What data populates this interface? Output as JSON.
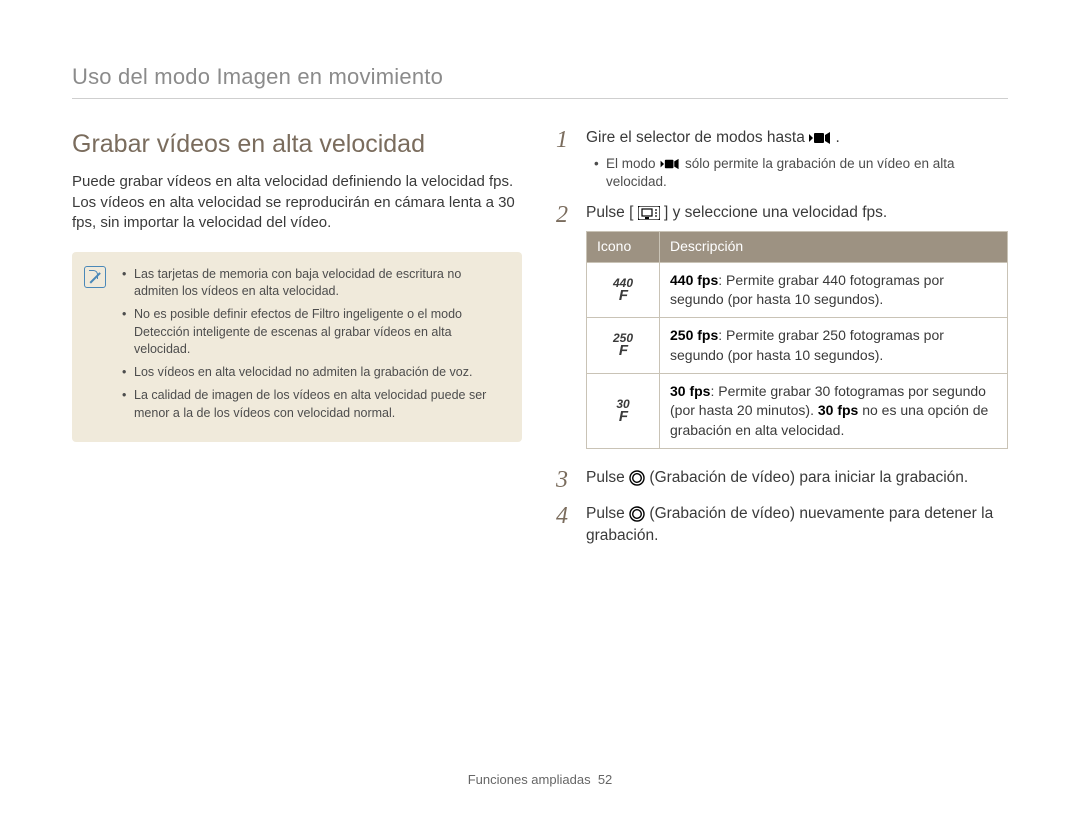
{
  "page_header": "Uso del modo Imagen en movimiento",
  "left": {
    "title": "Grabar vídeos en alta velocidad",
    "intro": "Puede grabar vídeos en alta velocidad definiendo la velocidad fps. Los vídeos en alta velocidad se reproducirán en cámara lenta a 30 fps, sin importar la velocidad del vídeo.",
    "note_bullets": [
      "Las tarjetas de memoria con baja velocidad de escritura no admiten los vídeos en alta velocidad.",
      "No es posible definir efectos de Filtro ingeligente o el modo Detección inteligente de escenas al grabar vídeos en alta velocidad.",
      "Los vídeos en alta velocidad no admiten la grabación de voz.",
      "La calidad de imagen de los vídeos en alta velocidad puede ser menor a la de los vídeos con velocidad normal."
    ]
  },
  "steps": {
    "s1": {
      "text_before": "Gire el selector de modos hasta ",
      "text_after": " .",
      "sub_before": "El modo ",
      "sub_after": " sólo permite la grabación de un vídeo en alta velocidad."
    },
    "s2": {
      "text_before": "Pulse [",
      "text_after": "] y seleccione una velocidad fps."
    },
    "s3": {
      "text_before": "Pulse ",
      "text_after": " (Grabación de vídeo) para iniciar la grabación."
    },
    "s4": {
      "text_before": "Pulse ",
      "text_mid": " (Grabación de vídeo) nuevamente para detener la grabación."
    }
  },
  "table": {
    "header_icon": "Icono",
    "header_desc": "Descripción",
    "rows": [
      {
        "icon_top": "440",
        "icon_bottom": "F",
        "bold": "440 fps",
        "desc": ": Permite grabar 440 fotogramas por segundo (por hasta 10 segundos).",
        "extra": ""
      },
      {
        "icon_top": "250",
        "icon_bottom": "F",
        "bold": "250 fps",
        "desc": ": Permite grabar 250 fotogramas por segundo (por hasta 10 segundos).",
        "extra": ""
      },
      {
        "icon_top": "30",
        "icon_bottom": "F",
        "bold": "30 fps",
        "desc": ": Permite grabar 30 fotogramas por segundo (por hasta 20 minutos). ",
        "extra_bold": "30 fps",
        "extra_tail": " no es una opción de grabación en alta velocidad."
      }
    ]
  },
  "footer_text": "Funciones ampliadas",
  "footer_page": "52"
}
